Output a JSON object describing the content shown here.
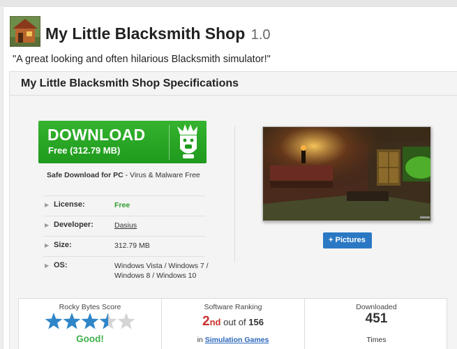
{
  "app": {
    "name": "My Little Blacksmith Shop",
    "version": "1.0",
    "tagline": "\"A great looking and often hilarious Blacksmith simulator!\""
  },
  "specs": {
    "heading": "My Little Blacksmith Shop Specifications",
    "download": {
      "label": "DOWNLOAD",
      "sub": "Free (312.79 MB)",
      "safe_prefix": "Safe Download for PC",
      "safe_suffix": " - Virus & Malware Free"
    },
    "rows": [
      {
        "label": "License:",
        "value": "Free"
      },
      {
        "label": "Developer:",
        "value": "Dasius"
      },
      {
        "label": "Size:",
        "value": "312.79 MB"
      },
      {
        "label": "OS:",
        "value": "Windows Vista / Windows 7 / Windows 8 / Windows 10"
      }
    ],
    "pictures_button": "+ Pictures"
  },
  "stats": {
    "score_label": "Rocky Bytes Score",
    "score_rating": 3.5,
    "score_max": 5,
    "score_text": "Good!",
    "ranking_label": "Software Ranking",
    "rank_num": "2",
    "rank_ord": "nd",
    "rank_mid": " out of ",
    "rank_total": "156",
    "rank_in": "in ",
    "rank_category": "Simulation Games",
    "downloaded_label": "Downloaded",
    "downloaded_value": "451",
    "downloaded_unit": "Times"
  },
  "colors": {
    "download_green": "#22a01f",
    "free_green": "#2e9a2e",
    "pictures_blue": "#2a78c4",
    "star_blue": "#2e86c8",
    "rank_red": "#c9302c"
  }
}
